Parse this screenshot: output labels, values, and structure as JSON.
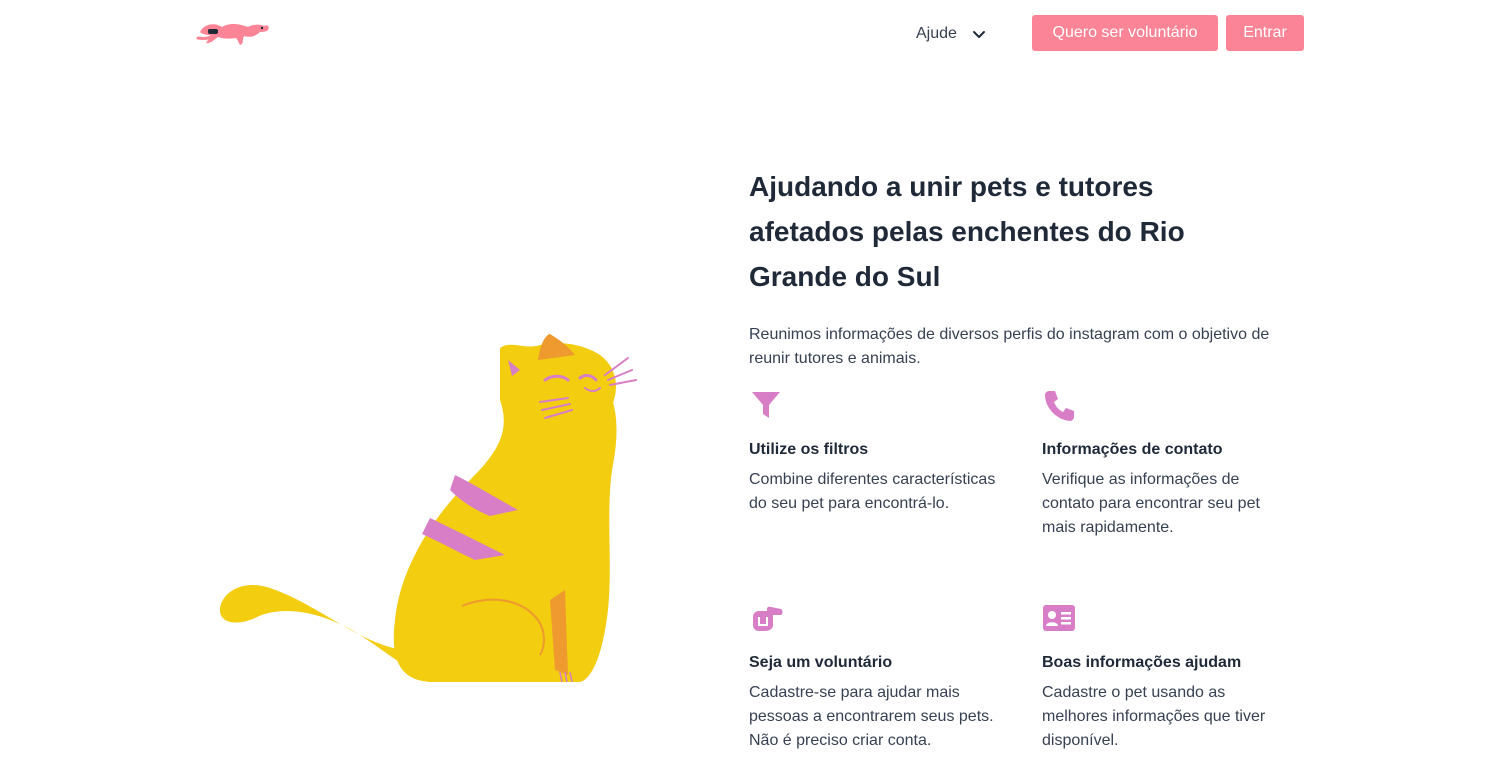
{
  "header": {
    "logo_icon": "running-dog-logo",
    "help_label": "Ajude",
    "help_icon": "chevron-down-icon",
    "volunteer_button": "Quero ser voluntário",
    "login_button": "Entrar"
  },
  "hero": {
    "illustration": "yellow-cat-illustration",
    "title": "Ajudando a unir pets e tutores afetados pelas enchentes do Rio Grande do Sul",
    "subtitle": "Reunimos informações de diversos perfis do instagram com o objetivo de reunir tutores e animais."
  },
  "features": [
    {
      "icon": "filter-icon",
      "title": "Utilize os filtros",
      "description": "Combine diferentes características do seu pet para encontrá-lo."
    },
    {
      "icon": "phone-icon",
      "title": "Informações de contato",
      "description": "Verifique as informações de contato para encontrar seu pet mais rapidamente."
    },
    {
      "icon": "hand-pointing-icon",
      "title": "Seja um voluntário",
      "description": "Cadastre-se para ajudar mais pessoas a encontrarem seus pets. Não é preciso criar conta."
    },
    {
      "icon": "id-card-icon",
      "title": "Boas informações ajudam",
      "description": "Cadastre o pet usando as melhores informações que tiver disponível."
    }
  ],
  "colors": {
    "accent": "#fc8497",
    "icon": "#d87ec6",
    "cat_body": "#f2cd10",
    "cat_stripe": "#d87ec6",
    "cat_ear": "#ee9a2f",
    "text_dark": "#1f2937",
    "text_body": "#374151"
  }
}
